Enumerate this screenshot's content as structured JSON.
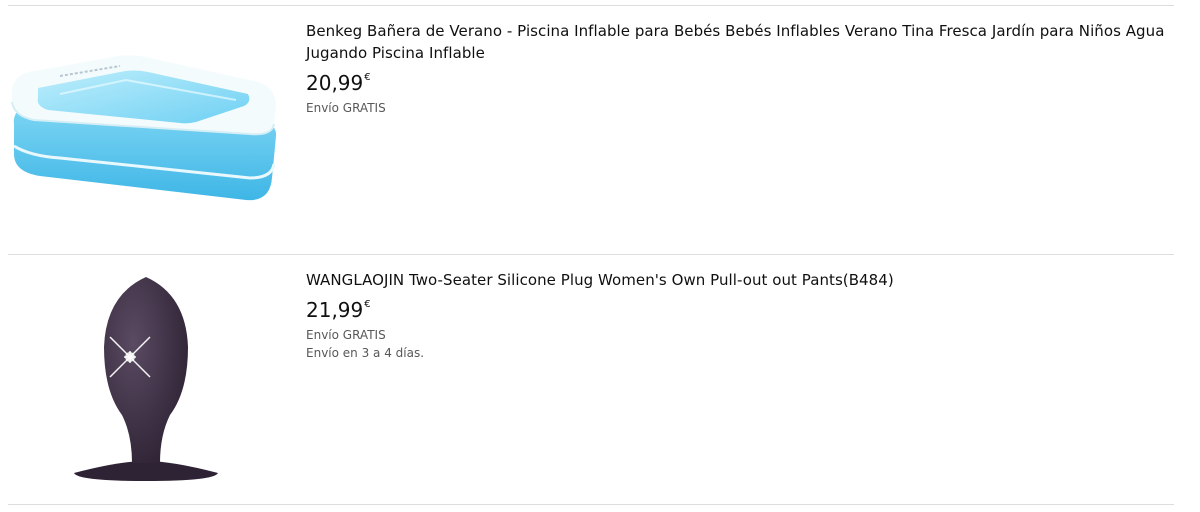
{
  "results": [
    {
      "title": "Benkeg Bañera de Verano - Piscina Inflable para Bebés Bebés Inflables Verano Tina Fresca Jardín para Niños Agua Jugando Piscina Inflable",
      "price_whole": "20,99",
      "currency": "€",
      "shipping": "Envío GRATIS",
      "image_icon": "inflatable-pool-image",
      "colors": {
        "pool_blue": "#4ec3ec",
        "pool_light": "#a8e4f8",
        "pool_white": "#f4fbfd"
      }
    },
    {
      "title": "WANGLAOJIN Two-Seater Silicone Plug Women's Own Pull-out out Pants(B484)",
      "price_whole": "21,99",
      "currency": "€",
      "shipping": "Envío GRATIS",
      "delivery": "Envío en 3 a 4 días.",
      "image_icon": "silicone-plug-image",
      "colors": {
        "product": "#3a2d40"
      }
    }
  ]
}
